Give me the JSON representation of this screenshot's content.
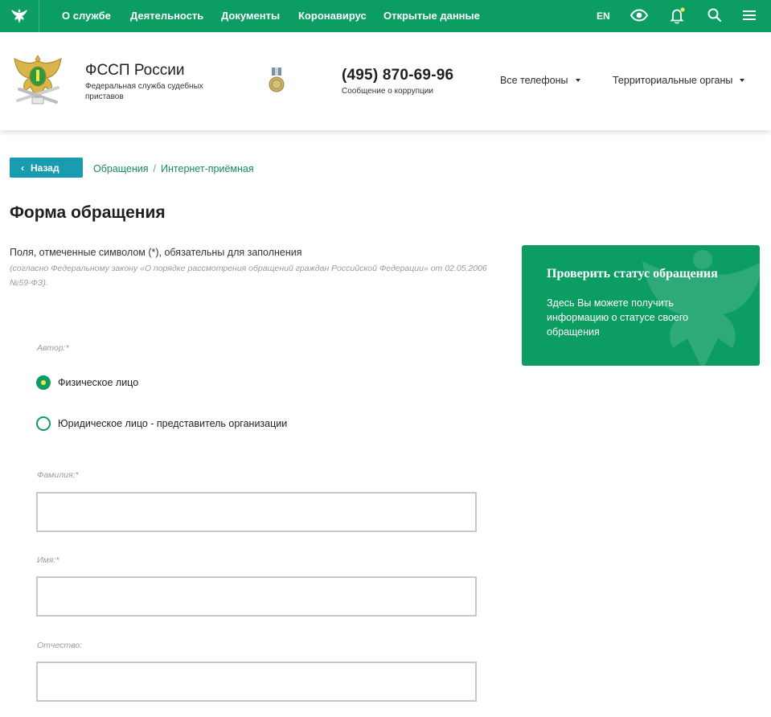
{
  "topnav": {
    "links": [
      "О службе",
      "Деятельность",
      "Документы",
      "Коронавирус",
      "Открытые данные"
    ],
    "lang": "EN"
  },
  "header": {
    "org_name": "ФССП России",
    "org_full": "Федеральная служба судебных приставов",
    "phone": "(495) 870-69-96",
    "phone_sub": "Сообщение о коррупции",
    "dropdown_phones": "Все телефоны",
    "dropdown_regions": "Территориальные органы"
  },
  "breadcrumb": {
    "back_label": "Назад",
    "items": [
      "Обращения",
      "Интернет-приёмная"
    ]
  },
  "page": {
    "title": "Форма обращения",
    "required_note": "Поля, отмеченные символом (*), обязательны для заполнения",
    "law_note": "(согласно Федеральному закону «О порядке рассмотрения обращений граждан Российской Федерации» от 02.05.2006 №59-ФЗ)."
  },
  "status_card": {
    "title": "Проверить статус обращения",
    "text": "Здесь Вы можете получить информацию о статусе своего обращения"
  },
  "form": {
    "author_label": "Автор:*",
    "author_options": [
      {
        "label": "Физическое лицо",
        "checked": true
      },
      {
        "label": "Юридическое лицо - представитель организации",
        "checked": false
      }
    ],
    "surname_label": "Фамилия:*",
    "surname_value": "",
    "name_label": "Имя:*",
    "name_value": "",
    "patronymic_label": "Отчество:",
    "patronymic_value": ""
  },
  "colors": {
    "brand_green": "#0c9d63",
    "back_button": "#1a9cb0",
    "link_green": "#178b5a",
    "notification_dot": "#f2e34a"
  }
}
